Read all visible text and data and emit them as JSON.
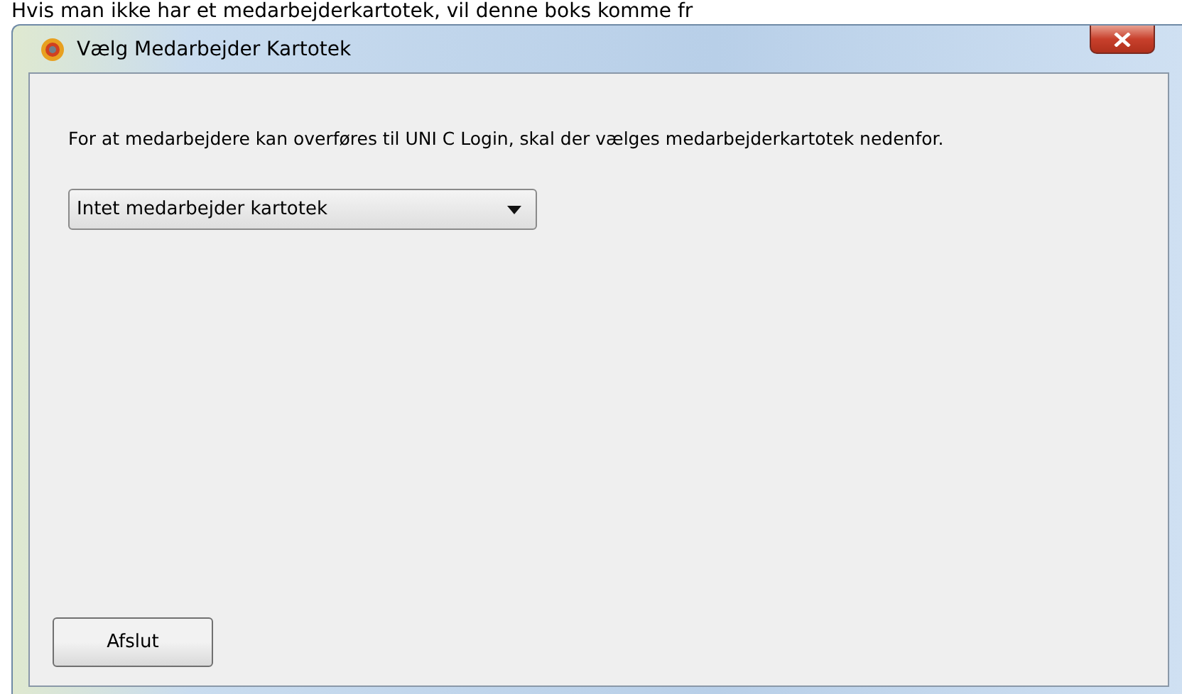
{
  "caption": "Hvis man ikke har et medarbejderkartotek, vil denne boks komme fr",
  "window": {
    "title": "Vælg Medarbejder Kartotek"
  },
  "instruction": "For at medarbejdere kan overføres til UNI C Login, skal der vælges medarbejderkartotek nedenfor.",
  "dropdown": {
    "value": "Intet medarbejder kartotek"
  },
  "buttons": [
    "Afslut"
  ]
}
